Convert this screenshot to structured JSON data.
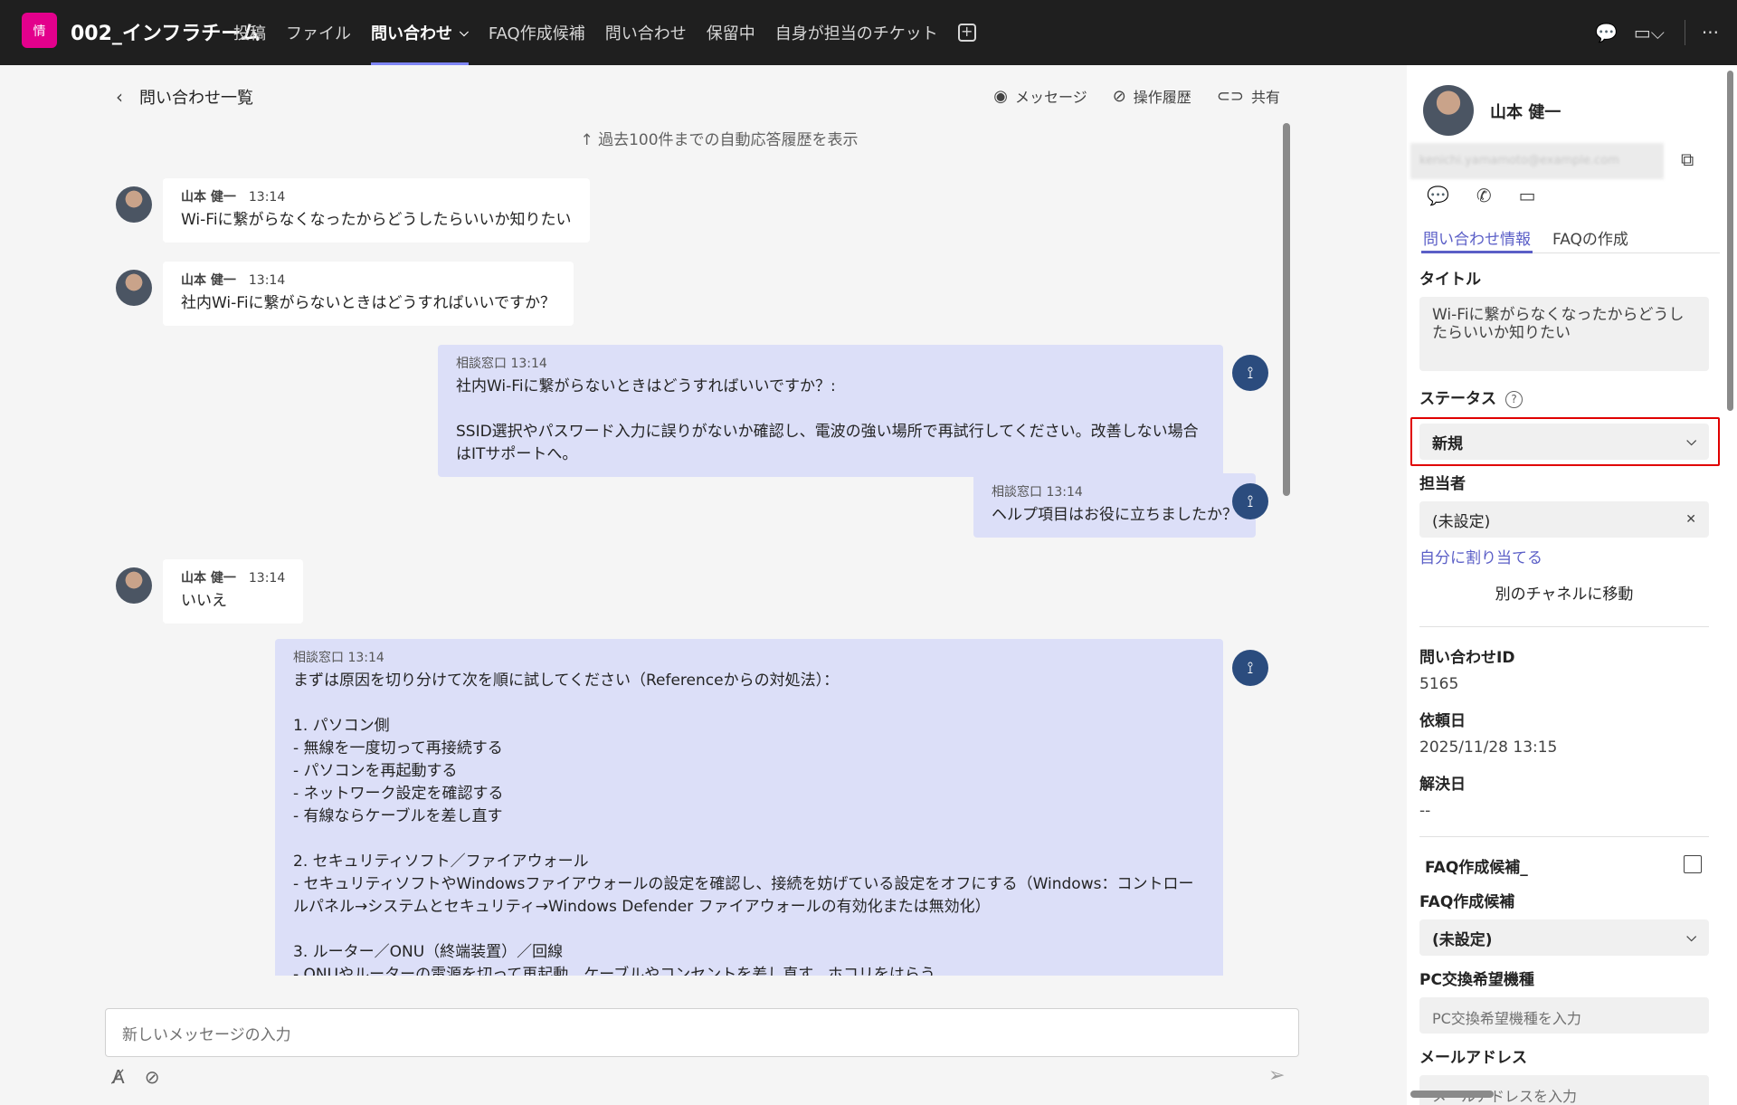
{
  "topbar": {
    "team_icon": "情",
    "team_name": "002_インフラチーム",
    "tabs": [
      {
        "label": "投稿"
      },
      {
        "label": "ファイル"
      },
      {
        "label": "問い合わせ"
      },
      {
        "label": "FAQ作成候補"
      },
      {
        "label": "問い合わせ"
      },
      {
        "label": "保留中"
      },
      {
        "label": "自身が担当のチケット"
      }
    ],
    "add_tab": "+",
    "more": "···"
  },
  "chat": {
    "back_label": "問い合わせ一覧",
    "actions": {
      "message": "メッセージ",
      "history": "操作履歴",
      "share": "共有"
    },
    "history_link": "↑ 過去100件までの自動応答履歴を表示",
    "messages": [
      {
        "sender": "山本 健一",
        "time": "13:14",
        "text": "Wi-Fiに繋がらなくなったからどうしたらいいか知りたい"
      },
      {
        "sender": "山本 健一",
        "time": "13:14",
        "text": "社内Wi-Fiに繋がらないときはどうすればいいですか？"
      },
      {
        "meta": "相談窓口 13:14",
        "text": "社内Wi-Fiに繋がらないときはどうすればいいですか？:\n\nSSID選択やパスワード入力に誤りがないか確認し、電波の強い場所で再試行してください。改善しない場合はITサポートへ。"
      },
      {
        "meta": "相談窓口 13:14",
        "text": "ヘルプ項目はお役に立ちましたか？"
      },
      {
        "sender": "山本 健一",
        "time": "13:14",
        "text": "いいえ"
      },
      {
        "meta": "相談窓口 13:14",
        "text": "まずは原因を切り分けて次を順に試してください（Referenceからの対処法）：\n\n1. パソコン側\n- 無線を一度切って再接続する\n- パソコンを再起動する\n- ネットワーク設定を確認する\n- 有線ならケーブルを差し直す\n\n2. セキュリティソフト／ファイアウォール\n- セキュリティソフトやWindowsファイアウォールの設定を確認し、接続を妨げている設定をオフにする（Windows：コントロールパネル→システムとセキュリティ→Windows Defender ファイアウォールの有効化または無効化）\n\n3. ルーター／ONU（終端装置）／回線\n- ONUやルーターの電源を切って再起動、ケーブルやコンセントを差し直す、ホコリをはらう"
      }
    ],
    "composer_placeholder": "新しいメッセージの入力"
  },
  "panel": {
    "user_name": "山本 健一",
    "email": "kenichi.yamamoto@example.com",
    "tabs": [
      {
        "label": "問い合わせ情報"
      },
      {
        "label": "FAQの作成"
      }
    ],
    "title_label": "タイトル",
    "title_value": "Wi-Fiに繋がらなくなったからどうしたらいいか知りたい",
    "status_label": "ステータス",
    "status_value": "新規",
    "assignee_label": "担当者",
    "assignee_value": "(未設定)",
    "assign_self": "自分に割り当てる",
    "move_channel": "別のチャネルに移動",
    "inquiry_id_label": "問い合わせID",
    "inquiry_id_value": "5165",
    "request_date_label": "依頼日",
    "request_date_value": "2025/11/28 13:15",
    "resolve_date_label": "解決日",
    "resolve_date_value": "--",
    "faq_checkbox_label": "FAQ作成候補_",
    "faq_label": "FAQ作成候補",
    "faq_value": "(未設定)",
    "pc_label": "PC交換希望機種",
    "pc_placeholder": "PC交換希望機種を入力",
    "mail_label": "メールアドレス",
    "mail_placeholder": "メールアドレスを入力"
  },
  "colors": {
    "accent": "#5b5fc7",
    "topbar": "#1f1f1f",
    "bot_bubble": "#dcdff8",
    "highlight": "#e00000",
    "team_icon": "#e3008c"
  }
}
